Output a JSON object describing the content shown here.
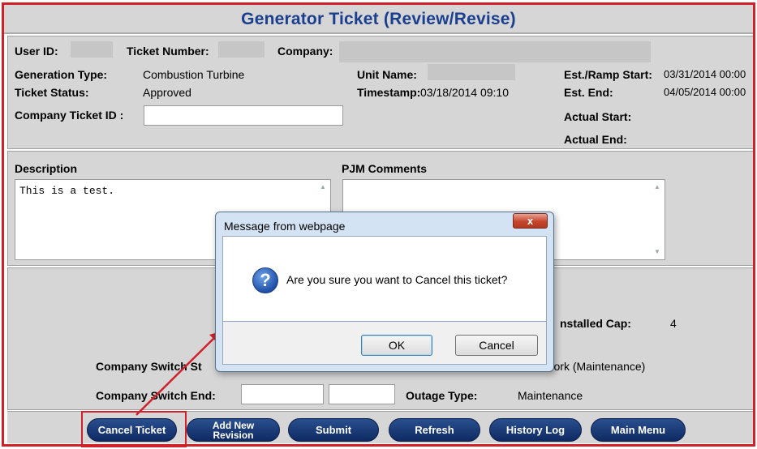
{
  "title": "Generator Ticket (Review/Revise)",
  "header": {
    "user_id_label": "User ID:",
    "ticket_number_label": "Ticket Number:",
    "company_label": "Company:"
  },
  "details": {
    "generation_type_label": "Generation Type:",
    "generation_type_value": "Combustion Turbine",
    "ticket_status_label": "Ticket Status:",
    "ticket_status_value": "Approved",
    "company_ticket_id_label": "Company Ticket ID :",
    "company_ticket_id_value": "",
    "unit_name_label": "Unit Name:",
    "timestamp_label": "Timestamp:",
    "timestamp_value": "03/18/2014 09:10",
    "est_ramp_start_label": "Est./Ramp Start:",
    "est_ramp_start_value": "03/31/2014 00:00",
    "est_end_label": "Est. End:",
    "est_end_value": "04/05/2014 00:00",
    "actual_start_label": "Actual Start:",
    "actual_end_label": "Actual End:"
  },
  "comments": {
    "description_label": "Description",
    "description_value": "This is a test.",
    "pjm_comments_label": "PJM Comments",
    "pjm_comments_value": ""
  },
  "lower": {
    "installed_cap_label": "nstalled Cap:",
    "installed_cap_value": "4",
    "company_switch_start_label": "Company Switch St",
    "work_type_value": "r Work (Maintenance)",
    "company_switch_end_label": "Company Switch End:",
    "outage_type_label": "Outage Type:",
    "outage_type_value": "Maintenance"
  },
  "buttons": {
    "cancel_ticket": "Cancel Ticket",
    "add_new_revision_line1": "Add New",
    "add_new_revision_line2": "Revision",
    "submit": "Submit",
    "refresh": "Refresh",
    "history_log": "History Log",
    "main_menu": "Main Menu"
  },
  "dialog": {
    "title": "Message from webpage",
    "close": "x",
    "message": "Are you sure you want to Cancel this ticket?",
    "ok": "OK",
    "cancel": "Cancel"
  },
  "colors": {
    "title_text": "#1b3f8f",
    "highlight_red": "#d0202a",
    "button_blue": "#0e2a63"
  }
}
